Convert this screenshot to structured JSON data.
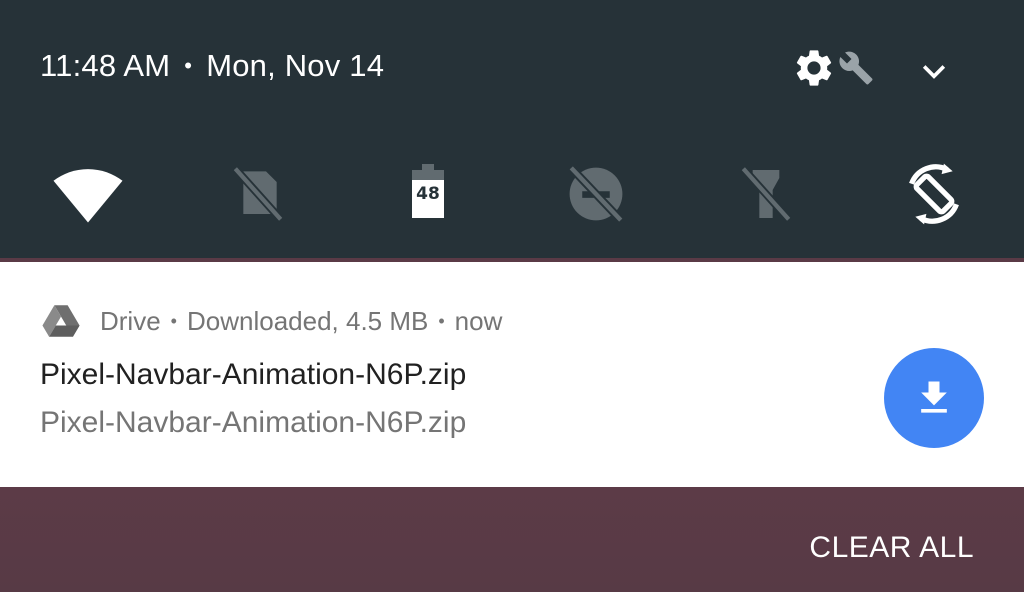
{
  "status_bar": {
    "time": "11:48 AM",
    "separator": "•",
    "date": "Mon, Nov 14",
    "icons": [
      "settings-gear-icon",
      "wrench-icon",
      "chevron-down-icon"
    ]
  },
  "quick_settings": {
    "tiles": [
      {
        "name": "wifi",
        "icon": "wifi-icon",
        "state": "on"
      },
      {
        "name": "mobile-data",
        "icon": "no-sim-icon",
        "state": "off"
      },
      {
        "name": "battery",
        "icon": "battery-icon",
        "level": "48",
        "state": "on"
      },
      {
        "name": "do-not-disturb",
        "icon": "dnd-off-icon",
        "state": "off"
      },
      {
        "name": "flashlight",
        "icon": "flashlight-off-icon",
        "state": "off"
      },
      {
        "name": "auto-rotate",
        "icon": "auto-rotate-icon",
        "state": "on"
      }
    ]
  },
  "notification": {
    "app_name": "Drive",
    "dot": "•",
    "status": "Downloaded, 4.5 MB",
    "time": "now",
    "title": "Pixel-Navbar-Animation-N6P.zip",
    "text": "Pixel-Navbar-Animation-N6P.zip",
    "action_icon": "download-icon",
    "accent_color": "#4285f4"
  },
  "footer": {
    "clear_all_label": "CLEAR ALL"
  },
  "colors": {
    "shade_background": "#263238",
    "wallpaper": "#5a3a46",
    "card_background": "#ffffff",
    "active_icon": "#ffffff",
    "inactive_icon": "#616b70"
  }
}
